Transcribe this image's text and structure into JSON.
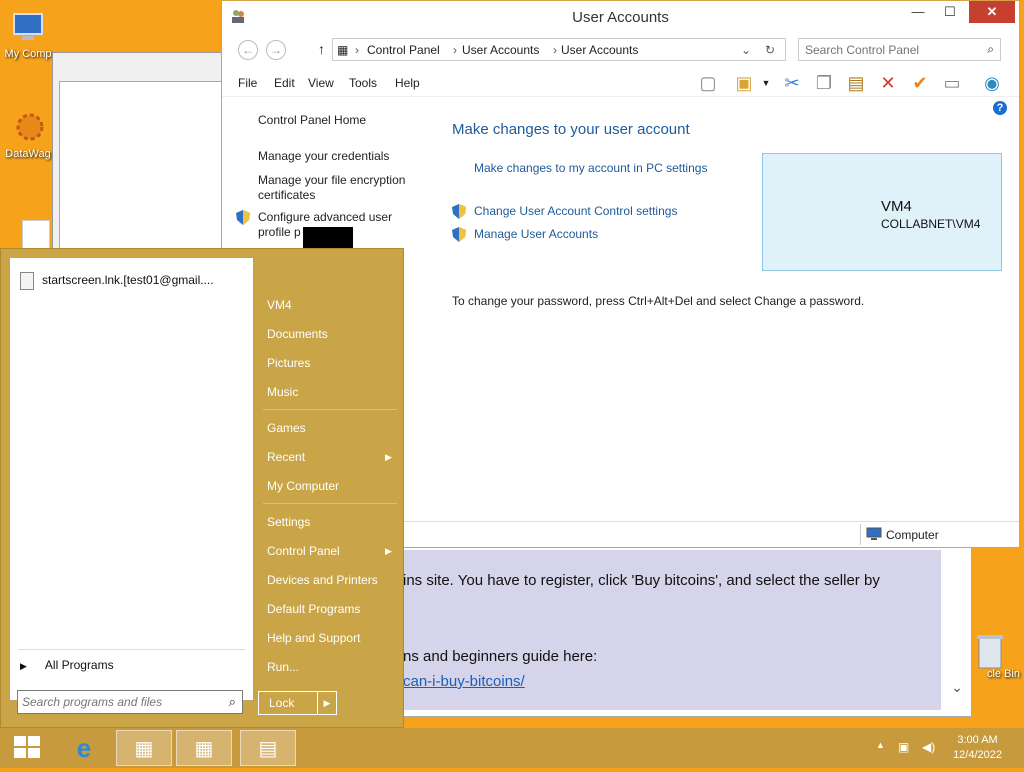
{
  "desktop": {
    "icons": [
      {
        "label": "My Comp"
      },
      {
        "label": "DataWag"
      },
      {
        "label": "cle Bin"
      }
    ]
  },
  "note": {
    "line1": "ins site. You have to register, click 'Buy bitcoins', and select the seller by",
    "line2": "ns and beginners guide here:",
    "link": "can-i-buy-bitcoins/"
  },
  "window": {
    "title": "User Accounts",
    "min": "—",
    "max": "☐",
    "close": "✕",
    "breadcrumb": [
      "Control Panel",
      "User Accounts",
      "User Accounts"
    ],
    "search_placeholder": "Search Control Panel",
    "menu": [
      "File",
      "Edit",
      "View",
      "Tools",
      "Help"
    ],
    "status_text": "Computer"
  },
  "leftnav": {
    "home": "Control Panel Home",
    "credentials": "Manage your credentials",
    "encryption": "Manage your file encryption certificates",
    "advanced": "Configure advanced user profile p"
  },
  "content": {
    "heading": "Make changes to your user account",
    "pc_settings": "Make changes to my account in PC settings",
    "uac": "Change User Account Control settings",
    "manage": "Manage User Accounts",
    "password_hint": "To change your password, press Ctrl+Alt+Del and select Change a password.",
    "user_name": "VM4",
    "user_domain": "COLLABNET\\VM4"
  },
  "start_menu": {
    "recent_item": "startscreen.lnk.[test01@gmail....",
    "all_programs": "All Programs",
    "search_placeholder": "Search programs and files",
    "right": {
      "user": "VM4",
      "documents": "Documents",
      "pictures": "Pictures",
      "music": "Music",
      "games": "Games",
      "recent": "Recent",
      "computer": "My Computer",
      "settings": "Settings",
      "control_panel": "Control Panel",
      "devices": "Devices and Printers",
      "defaults": "Default Programs",
      "help": "Help and Support",
      "run": "Run..."
    },
    "lock": "Lock"
  },
  "taskbar": {
    "time": "3:00 AM",
    "date": "12/4/2022"
  },
  "colors": {
    "desktop": "#f6a21a",
    "start_menu": "#c9a548",
    "link": "#1e5b9a"
  }
}
